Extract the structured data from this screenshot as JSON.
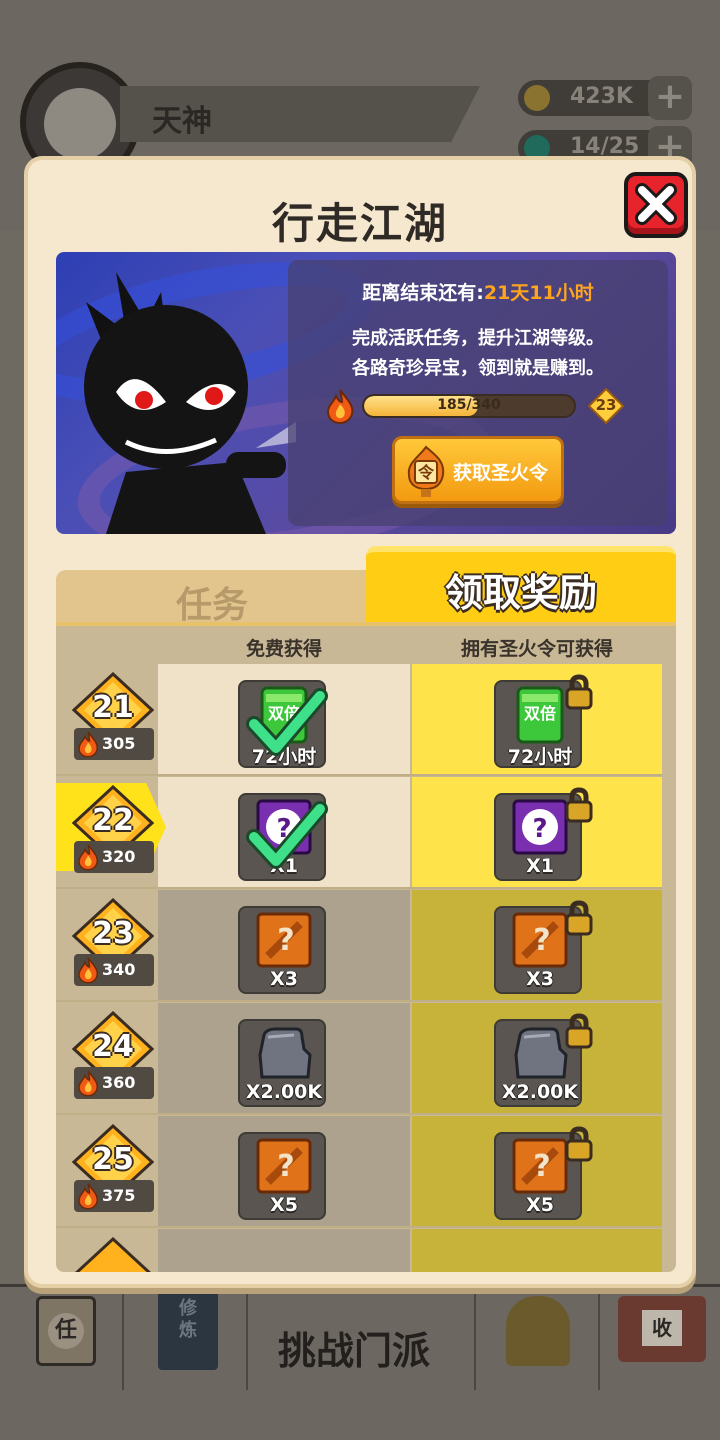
{
  "background": {
    "player_name": "天神",
    "resources": [
      {
        "value": "423K",
        "icon": "coin-icon"
      },
      {
        "value": "14/25",
        "icon": "gem-icon"
      }
    ],
    "bottom_nav": {
      "task_icon_char": "任",
      "book_text": "修炼",
      "challenge_label": "挑战门派",
      "shop_sign_char": "收"
    }
  },
  "modal": {
    "title": "行走江湖",
    "close_icon": "close-icon",
    "banner": {
      "countdown_label": "距离结束还有:",
      "countdown_value": "21天11小时",
      "desc_line1": "完成活跃任务，提升江湖等级。",
      "desc_line2": "各路奇珍异宝，领到就是赚到。",
      "progress_text": "185/340",
      "progress_fraction": 0.544,
      "level": "23",
      "token_icon_char": "令",
      "get_token_button": "获取圣火令"
    },
    "tabs": {
      "tasks": "任务",
      "rewards": "领取奖励"
    },
    "table": {
      "free_header": "免费获得",
      "paid_header": "拥有圣火令可获得",
      "rows": [
        {
          "level": "21",
          "points": "305",
          "item": "double-card",
          "art_text": "双倍",
          "qty": "72小时",
          "claimed": true,
          "current": false
        },
        {
          "level": "22",
          "points": "320",
          "item": "mystery-purple",
          "art_text": "?",
          "qty": "X1",
          "claimed": true,
          "current": true
        },
        {
          "level": "23",
          "points": "340",
          "item": "mystery-orange",
          "art_text": "?",
          "qty": "X3",
          "claimed": false,
          "current": false
        },
        {
          "level": "24",
          "points": "360",
          "item": "stone",
          "art_text": "",
          "qty": "X2.00K",
          "claimed": false,
          "current": false
        },
        {
          "level": "25",
          "points": "375",
          "item": "mystery-orange",
          "art_text": "?",
          "qty": "X5",
          "claimed": false,
          "current": false
        }
      ]
    }
  },
  "colors": {
    "modal_bg": "#f5e8cf",
    "accent_yellow": "#ffcd14",
    "countdown_orange": "#ffa41f",
    "close_red": "#e7232c"
  }
}
